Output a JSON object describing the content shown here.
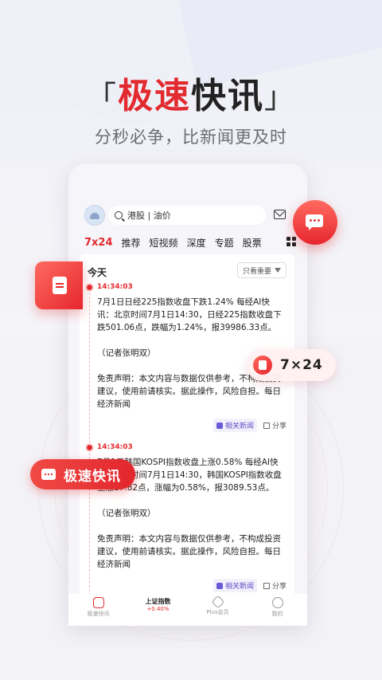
{
  "hero": {
    "bracket_open": "「",
    "title_red": "极速",
    "title_dark": "快讯",
    "bracket_close": "」",
    "subtitle": "分秒必争，比新闻更及时"
  },
  "app": {
    "search_text": "港股 | 油价",
    "tabs": [
      {
        "label": "7x24",
        "active": true
      },
      {
        "label": "推荐"
      },
      {
        "label": "短视频"
      },
      {
        "label": "深度"
      },
      {
        "label": "专题"
      },
      {
        "label": "股票"
      }
    ],
    "feed": {
      "section_title": "今天",
      "filter_label": "只看重要",
      "items": [
        {
          "time": "14:34:03",
          "paragraphs": [
            "7月1日日经225指数收盘下跌1.24% 每经AI快讯：北京时间7月1日14:30，日经225指数收盘下跌501.06点，跌幅为1.24%，报39986.33点。",
            "（记者张明双）",
            "免责声明：本文内容与数据仅供参考，不构成投资建议，使用前请核实。据此操作，风险自担。每日经济新闻"
          ],
          "related_label": "相关新闻",
          "share_label": "分享"
        },
        {
          "time": "14:34:03",
          "paragraphs": [
            "7月1日韩国KOSPI指数收盘上涨0.58% 每经AI快讯：北京时间7月1日14:30，韩国KOSPI指数收盘上涨17.82点，涨幅为0.58%，报3089.53点。",
            "（记者张明双）",
            "免责声明：本文内容与数据仅供参考，不构成投资建议，使用前请核实。据此操作，风险自担。每日经济新闻"
          ],
          "related_label": "相关新闻",
          "share_label": "分享"
        }
      ]
    },
    "bottom_nav": {
      "flash_label": "极速快讯",
      "index_name": "上证指数",
      "index_change": "+0.40%",
      "plus_label": "Plus会员",
      "mine_label": "我的"
    }
  },
  "floating": {
    "pill_724": "7×24",
    "pill_flash": "极速快讯"
  },
  "colors": {
    "accent": "#e22a2f",
    "text_dark": "#222222",
    "subtitle": "#6c6c74"
  }
}
